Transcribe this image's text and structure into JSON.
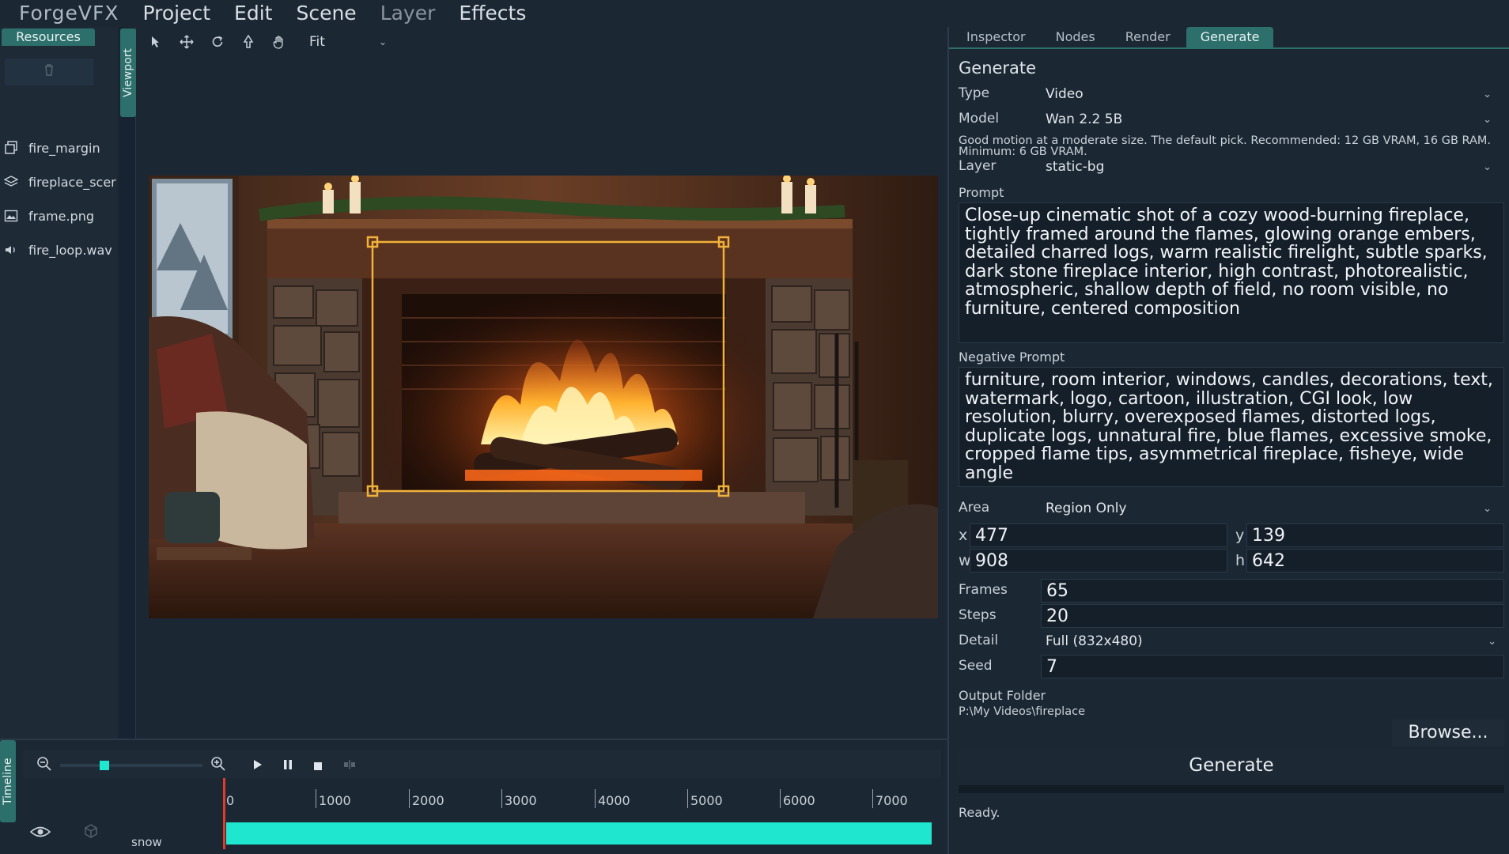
{
  "menu": {
    "app_name": "ForgeVFX",
    "items": [
      "Project",
      "Edit",
      "Scene",
      "Layer",
      "Effects"
    ]
  },
  "resources": {
    "tab_label": "Resources",
    "items": [
      {
        "label": "fire_margin",
        "icon": "sequence-icon"
      },
      {
        "label": "fireplace_scer",
        "icon": "layers-icon"
      },
      {
        "label": "frame.png",
        "icon": "image-icon"
      },
      {
        "label": "fire_loop.wav",
        "icon": "audio-icon"
      }
    ]
  },
  "viewport": {
    "tab_label": "Viewport",
    "zoom": "Fit"
  },
  "inspector": {
    "tabs": [
      "Inspector",
      "Nodes",
      "Render",
      "Generate"
    ],
    "active_tab": "Generate",
    "section_title": "Generate",
    "type_label": "Type",
    "type_value": "Video",
    "model_label": "Model",
    "model_value": "Wan 2.2 5B",
    "model_hint": "Good motion at a moderate size. The default pick.  Recommended: 12 GB VRAM, 16 GB RAM. Minimum: 6 GB VRAM.",
    "layer_label": "Layer",
    "layer_value": "static-bg",
    "prompt_label": "Prompt",
    "prompt": "Close-up cinematic shot of a cozy wood-burning fireplace, tightly framed around the flames, glowing orange embers, detailed charred logs, warm realistic firelight, subtle sparks, dark stone fireplace interior, high contrast, photorealistic, atmospheric, shallow depth of field, no room visible, no furniture, centered composition",
    "negative_label": "Negative Prompt",
    "negative_prompt": "furniture, room interior, windows, candles, decorations, text, watermark, logo, cartoon, illustration, CGI look, low resolution, blurry, overexposed flames, distorted logs, duplicate logs, unnatural fire, blue flames, excessive smoke, cropped flame tips, asymmetrical fireplace, fisheye, wide angle",
    "area_label": "Area",
    "area_value": "Region Only",
    "x_label": "x",
    "x_value": "477",
    "y_label": "y",
    "y_value": "139",
    "w_label": "w",
    "w_value": "908",
    "h_label": "h",
    "h_value": "642",
    "frames_label": "Frames",
    "frames_value": "65",
    "steps_label": "Steps",
    "steps_value": "20",
    "detail_label": "Detail",
    "detail_value": "Full (832x480)",
    "seed_label": "Seed",
    "seed_value": "7",
    "output_label": "Output Folder",
    "output_path": "P:\\My Videos\\fireplace",
    "browse_label": "Browse...",
    "generate_label": "Generate",
    "progress": 0,
    "status": "Ready."
  },
  "timeline": {
    "tab_label": "Timeline",
    "ticks": [
      "0",
      "1000",
      "2000",
      "3000",
      "4000",
      "5000",
      "6000",
      "7000"
    ],
    "track_name": "snow"
  },
  "colors": {
    "accent": "#2c6f6b",
    "track": "#1fe6cf",
    "selection": "#f0b23a",
    "playhead": "#e23b2e"
  }
}
